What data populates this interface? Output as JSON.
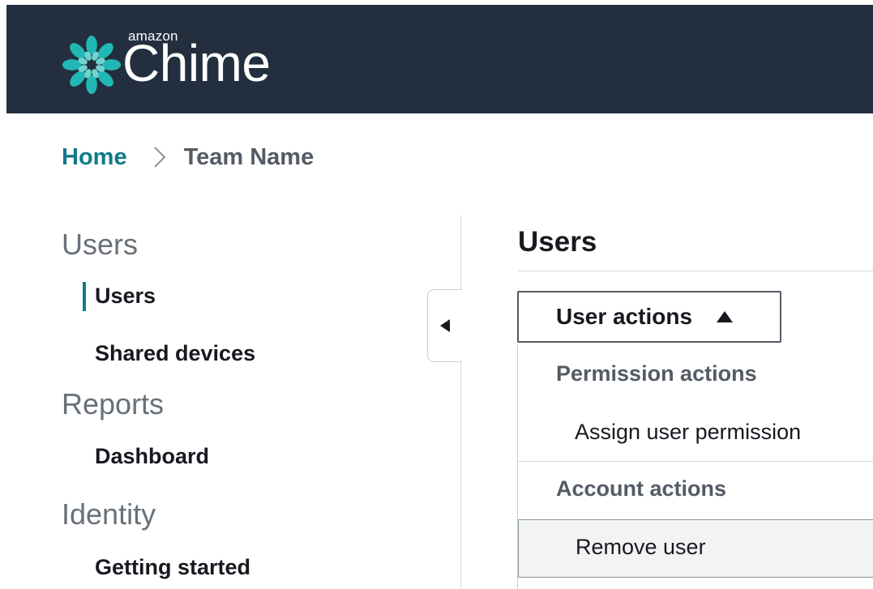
{
  "header": {
    "logo_small_text": "amazon",
    "logo_text": "Chime"
  },
  "breadcrumb": {
    "home": "Home",
    "current": "Team Name"
  },
  "nav": {
    "sections": [
      {
        "label": "Users",
        "items": [
          {
            "label": "Users",
            "active": true
          },
          {
            "label": "Shared devices",
            "active": false
          }
        ]
      },
      {
        "label": "Reports",
        "items": [
          {
            "label": "Dashboard",
            "active": false
          }
        ]
      },
      {
        "label": "Identity",
        "items": [
          {
            "label": "Getting started",
            "active": false
          }
        ]
      }
    ]
  },
  "main": {
    "title": "Users",
    "actions_button": "User actions",
    "menu": {
      "groups": [
        {
          "label": "Permission actions",
          "items": [
            {
              "label": "Assign user permission"
            }
          ]
        },
        {
          "label": "Account actions",
          "items": [
            {
              "label": "Remove user",
              "highlighted": true
            }
          ]
        }
      ]
    }
  },
  "colors": {
    "header_bg": "#232f3e",
    "accent": "#0f7b89",
    "logo_teal": "#21b7b4"
  }
}
